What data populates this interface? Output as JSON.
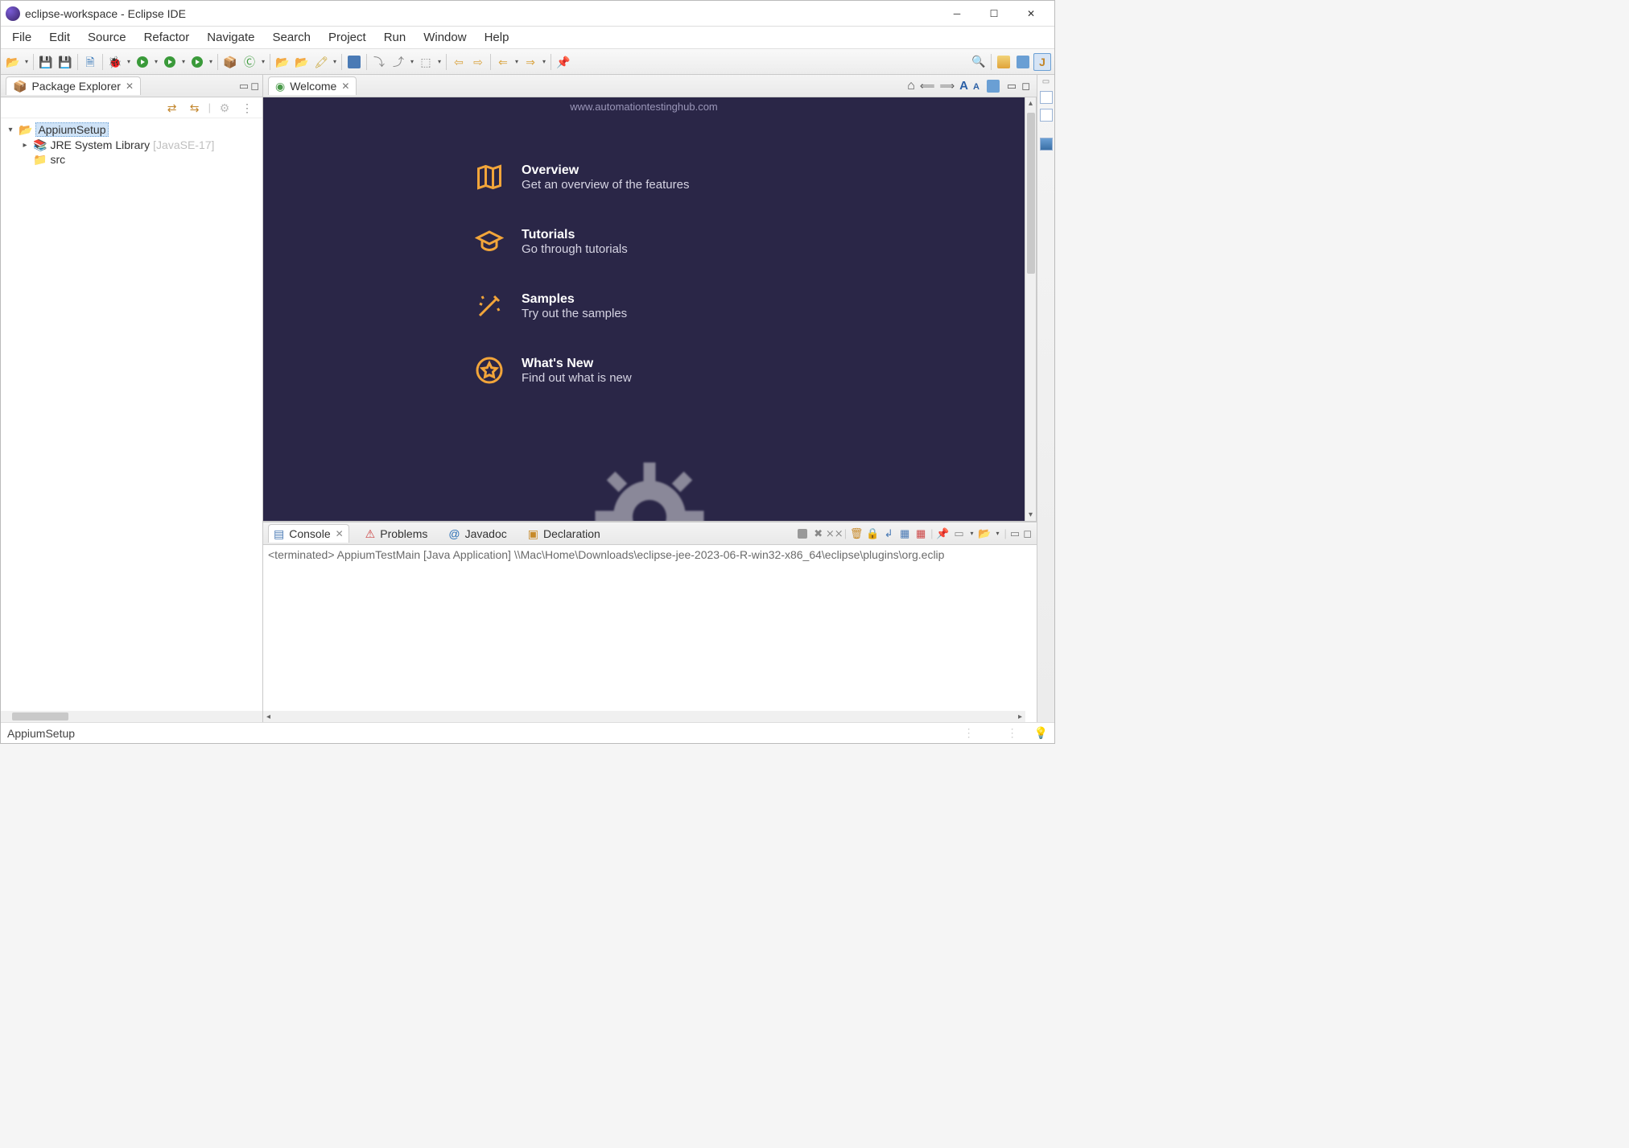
{
  "title": "eclipse-workspace - Eclipse IDE",
  "menu": {
    "items": [
      "File",
      "Edit",
      "Source",
      "Refactor",
      "Navigate",
      "Search",
      "Project",
      "Run",
      "Window",
      "Help"
    ]
  },
  "packageExplorer": {
    "title": "Package Explorer",
    "project": "AppiumSetup",
    "library": "JRE System Library",
    "libraryQualifier": "[JavaSE-17]",
    "srcFolder": "src"
  },
  "editor": {
    "tabTitle": "Welcome",
    "url": "www.automationtestinghub.com",
    "items": [
      {
        "title": "Overview",
        "subtitle": "Get an overview of the features",
        "icon": "map"
      },
      {
        "title": "Tutorials",
        "subtitle": "Go through tutorials",
        "icon": "grad"
      },
      {
        "title": "Samples",
        "subtitle": "Try out the samples",
        "icon": "wand"
      },
      {
        "title": "What's New",
        "subtitle": "Find out what is new",
        "icon": "star"
      }
    ]
  },
  "bottom": {
    "tabs": [
      "Console",
      "Problems",
      "Javadoc",
      "Declaration"
    ],
    "consoleLine": "<terminated> AppiumTestMain [Java Application] \\\\Mac\\Home\\Downloads\\eclipse-jee-2023-06-R-win32-x86_64\\eclipse\\plugins\\org.eclip"
  },
  "status": {
    "left": "AppiumSetup"
  }
}
